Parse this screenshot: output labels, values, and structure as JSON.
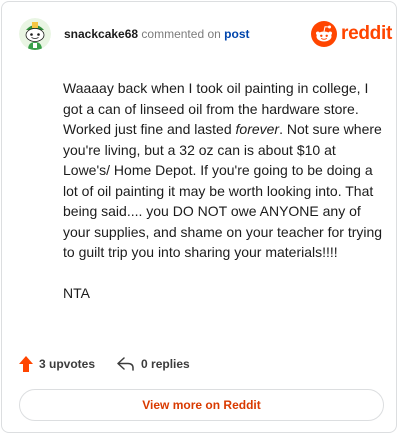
{
  "header": {
    "username": "snackcake68",
    "action": "commented on",
    "target": "post"
  },
  "brand": {
    "name": "reddit",
    "color": "#ff4500",
    "icon": "reddit-snoo-icon"
  },
  "avatar": {
    "icon": "snoo-avatar-icon"
  },
  "comment": {
    "p1_before": "Waaaay back when I took oil painting in college, I got a can of linseed oil from the hardware store. Worked just fine and lasted ",
    "p1_emphasis": "forever",
    "p1_after": ". Not sure where you're living, but a 32 oz can is about $10 at Lowe's/ Home Depot. If you're going to be doing a lot of oil painting it may be worth looking into. That being said.... you DO NOT owe ANYONE any of your supplies, and shame on your teacher for trying to guilt trip you into sharing your materials!!!!",
    "p2": "NTA"
  },
  "stats": {
    "upvotes_label": "3 upvotes",
    "upvote_icon": "upvote-arrow-icon",
    "replies_label": "0 replies",
    "reply_icon": "reply-arrow-icon"
  },
  "view_more": {
    "label": "View more on Reddit"
  }
}
